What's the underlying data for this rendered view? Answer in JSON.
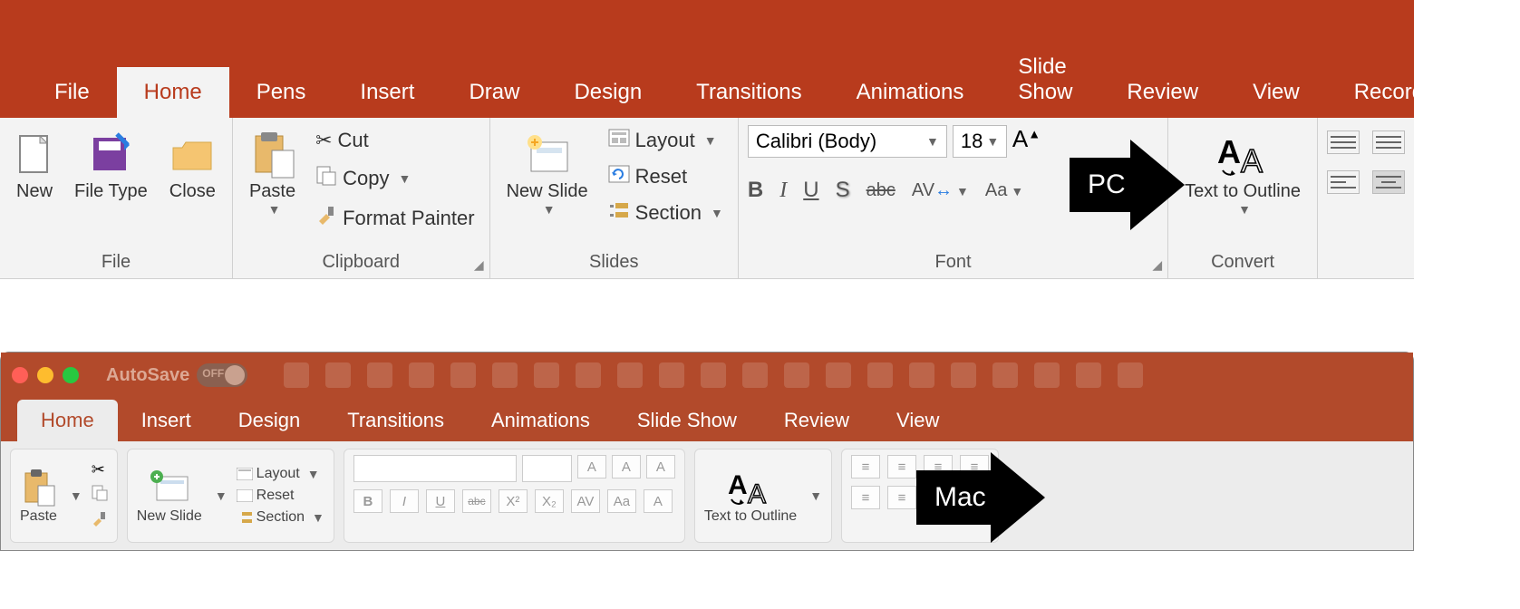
{
  "pc": {
    "tabs": [
      "File",
      "Home",
      "Pens",
      "Insert",
      "Draw",
      "Design",
      "Transitions",
      "Animations",
      "Slide Show",
      "Review",
      "View",
      "Recording"
    ],
    "active_tab": "Home",
    "groups": {
      "file": {
        "label": "File",
        "new": "New",
        "filetype": "File Type",
        "close": "Close"
      },
      "clipboard": {
        "label": "Clipboard",
        "paste": "Paste",
        "cut": "Cut",
        "copy": "Copy",
        "format_painter": "Format Painter"
      },
      "slides": {
        "label": "Slides",
        "new_slide": "New Slide",
        "layout": "Layout",
        "reset": "Reset",
        "section": "Section"
      },
      "font": {
        "label": "Font",
        "font_name": "Calibri (Body)",
        "font_size": "18",
        "bold": "B",
        "italic": "I",
        "underline": "U",
        "shadow": "S",
        "strike": "abc",
        "spacing": "AV",
        "case": "Aa"
      },
      "convert": {
        "label": "Convert",
        "text_to_outline": "Text to Outline"
      }
    },
    "arrow_label": "PC"
  },
  "mac": {
    "autosave_label": "AutoSave",
    "autosave_state": "OFF",
    "tabs": [
      "Home",
      "Insert",
      "Design",
      "Transitions",
      "Animations",
      "Slide Show",
      "Review",
      "View"
    ],
    "active_tab": "Home",
    "paste": "Paste",
    "new_slide": "New Slide",
    "layout": "Layout",
    "reset": "Reset",
    "section": "Section",
    "text_to_outline": "Text to Outline",
    "bold": "B",
    "italic": "I",
    "underline": "U",
    "strike": "abc",
    "super": "X²",
    "sub": "X₂",
    "spacing": "AV",
    "case": "Aa",
    "arrow_label": "Mac"
  }
}
